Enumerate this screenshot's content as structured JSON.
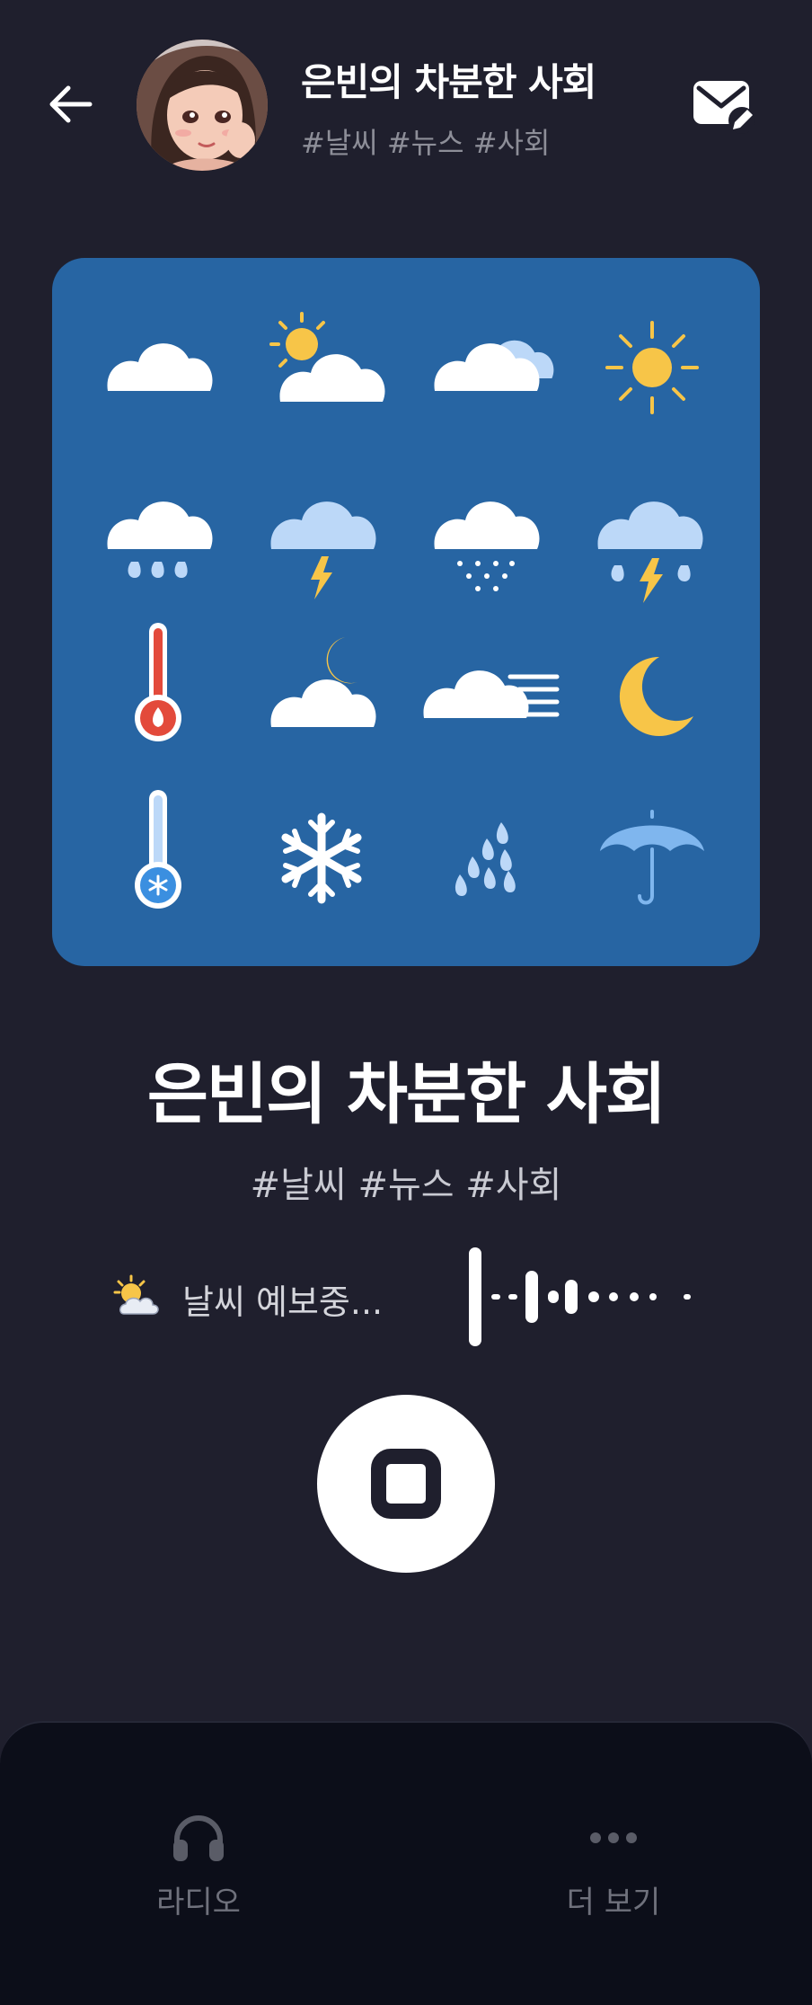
{
  "header": {
    "title": "은빈의 차분한 사회",
    "tags": "#날씨 #뉴스 #사회",
    "back_icon": "arrow-left-icon",
    "mail_icon": "mail-edit-icon"
  },
  "artwork": {
    "icons": [
      "cloud-icon",
      "sun-behind-cloud-icon",
      "clouds-icon",
      "sun-icon",
      "rain-cloud-icon",
      "thunder-cloud-icon",
      "snow-cloud-icon",
      "thunderstorm-rain-icon",
      "hot-thermometer-icon",
      "moon-behind-cloud-icon",
      "windy-cloud-icon",
      "crescent-moon-icon",
      "cold-thermometer-icon",
      "snowflake-icon",
      "raindrops-icon",
      "umbrella-icon"
    ],
    "background_color": "#2765a3"
  },
  "player": {
    "title": "은빈의 차분한 사회",
    "tags": "#날씨 #뉴스 #사회",
    "status_text": "날씨 예보중...",
    "status_icon": "sun-behind-cloud-emoji",
    "control_icon": "stop-icon"
  },
  "nav": {
    "radio_label": "라디오",
    "radio_icon": "headphones-icon",
    "more_label": "더 보기",
    "more_icon": "ellipsis-icon"
  },
  "colors": {
    "background": "#1f1f2d",
    "nav_background": "#0c0e19",
    "card": "#2765a3",
    "accent_yellow": "#f7c548",
    "accent_red": "#e34a3b"
  }
}
